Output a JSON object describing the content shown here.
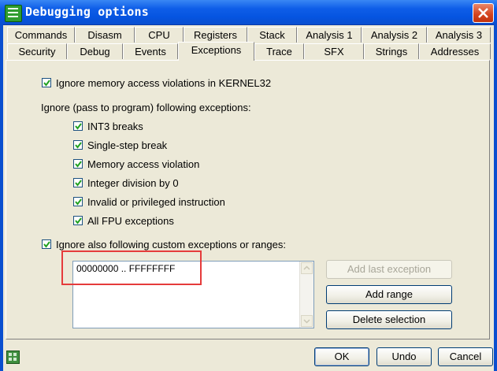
{
  "window": {
    "title": "Debugging options"
  },
  "tabs_row1": [
    "Commands",
    "Disasm",
    "CPU",
    "Registers",
    "Stack",
    "Analysis 1",
    "Analysis 2",
    "Analysis 3"
  ],
  "tabs_row2": [
    "Security",
    "Debug",
    "Events",
    "Exceptions",
    "Trace",
    "SFX",
    "Strings",
    "Addresses"
  ],
  "active_tab": "Exceptions",
  "options": {
    "ignore_kernel32": {
      "label": "Ignore memory access violations in KERNEL32",
      "checked": true
    },
    "ignore_heading": "Ignore (pass to program) following exceptions:",
    "exceptions": [
      {
        "label": "INT3 breaks",
        "checked": true
      },
      {
        "label": "Single-step break",
        "checked": true
      },
      {
        "label": "Memory access violation",
        "checked": true
      },
      {
        "label": "Integer division by 0",
        "checked": true
      },
      {
        "label": "Invalid or privileged instruction",
        "checked": true
      },
      {
        "label": "All FPU exceptions",
        "checked": true
      }
    ],
    "custom": {
      "label": "Ignore also following custom exceptions or ranges:",
      "checked": true
    }
  },
  "range_list": {
    "items": [
      "00000000 .. FFFFFFFF"
    ]
  },
  "side_buttons": {
    "add_last": "Add last exception",
    "add_range": "Add range",
    "delete_selection": "Delete selection"
  },
  "bottom_buttons": {
    "ok": "OK",
    "undo": "Undo",
    "cancel": "Cancel"
  },
  "colors": {
    "titlebar": "#0554e0",
    "highlight": "#e53b3b",
    "panel": "#ece9d8"
  },
  "icons": {
    "app": "list-icon",
    "close": "close-icon",
    "status": "grid-icon"
  }
}
